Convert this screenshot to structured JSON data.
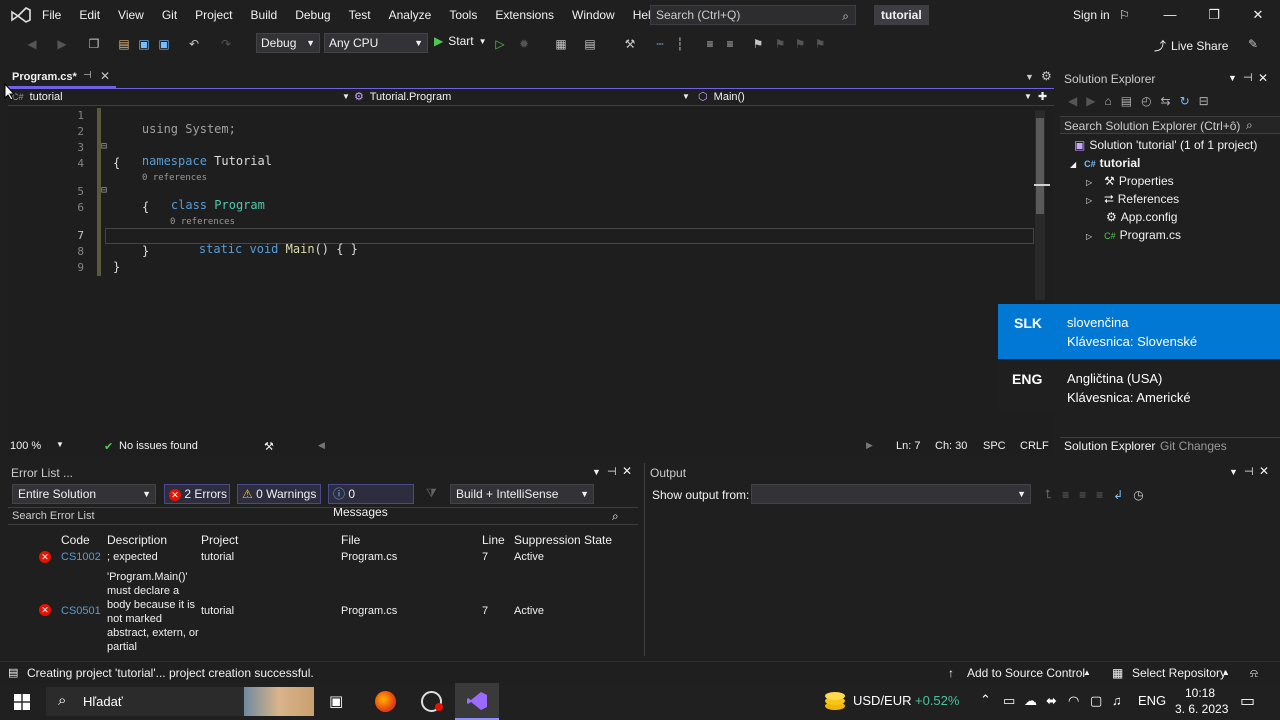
{
  "menubar": {
    "items": [
      "File",
      "Edit",
      "View",
      "Git",
      "Project",
      "Build",
      "Debug",
      "Test",
      "Analyze",
      "Tools",
      "Extensions",
      "Window",
      "Help"
    ],
    "search_placeholder": "Search (Ctrl+Q)",
    "solution_name": "tutorial",
    "sign_in": "Sign in"
  },
  "toolbar": {
    "config": "Debug",
    "platform": "Any CPU",
    "start": "Start",
    "live_share": "Live Share"
  },
  "editor": {
    "tab_label": "Program.cs*",
    "nav_project": "tutorial",
    "nav_class": "Tutorial.Program",
    "nav_member": "Main()",
    "lines": [
      {
        "n": "1",
        "current": false
      },
      {
        "n": "2",
        "current": false
      },
      {
        "n": "3",
        "current": false
      },
      {
        "n": "4",
        "current": false
      },
      {
        "n": "5",
        "current": false
      },
      {
        "n": "6",
        "current": false
      },
      {
        "n": "7",
        "current": true
      },
      {
        "n": "8",
        "current": false
      },
      {
        "n": "9",
        "current": false
      }
    ],
    "code": {
      "using_kw": "using",
      "using_rest": "System;",
      "namespace_kw": "namespace",
      "namespace_name": "Tutorial",
      "open_brace": "{",
      "close_brace": "}",
      "lens_class": "0 references",
      "class_kw": "class",
      "class_name": "Program",
      "lens_method": "0 references",
      "static_kw": "static",
      "void_kw": "void",
      "method_name": "Main",
      "method_rest": "() { }"
    },
    "zoom": "100 %",
    "issues": "No issues found",
    "ln": "Ln: 7",
    "ch": "Ch: 30",
    "spc": "SPC",
    "crlf": "CRLF"
  },
  "solution_explorer": {
    "title": "Solution Explorer",
    "search_placeholder": "Search Solution Explorer (Ctrl+ô)",
    "items": [
      {
        "label": "Solution 'tutorial' (1 of 1 project)",
        "bold": false
      },
      {
        "label": "tutorial",
        "bold": true
      },
      {
        "label": "Properties",
        "bold": false
      },
      {
        "label": "References",
        "bold": false
      },
      {
        "label": "App.config",
        "bold": false
      },
      {
        "label": "Program.cs",
        "bold": false
      }
    ],
    "tab_active": "Solution Explorer",
    "tab_other": "Git Changes"
  },
  "language_popup": {
    "languages": [
      {
        "code": "SLK",
        "name": "slovenčina",
        "keyboard": "Klávesnica: Slovenské",
        "selected": true
      },
      {
        "code": "ENG",
        "name": "Angličtina (USA)",
        "keyboard": "Klávesnica: Americké",
        "selected": false
      }
    ]
  },
  "error_list": {
    "title": "Error List ...",
    "scope": "Entire Solution",
    "errors_btn": "2 Errors",
    "warnings_btn": "0 Warnings",
    "messages_btn": "0 Messages",
    "source": "Build + IntelliSense",
    "search_placeholder": "Search Error List",
    "columns": [
      "Code",
      "Description",
      "Project",
      "File",
      "Line",
      "Suppression State"
    ],
    "rows": [
      {
        "code": "CS1002",
        "description": "; expected",
        "project": "tutorial",
        "file": "Program.cs",
        "line": "7",
        "state": "Active"
      },
      {
        "code": "CS0501",
        "description": "'Program.Main()' must declare a body because it is not marked abstract, extern, or partial",
        "project": "tutorial",
        "file": "Program.cs",
        "line": "7",
        "state": "Active"
      }
    ]
  },
  "output": {
    "title": "Output",
    "show_from": "Show output from:"
  },
  "statusbar": {
    "message": "Creating project 'tutorial'... project creation successful.",
    "add_source": "Add to Source Control",
    "select_repo": "Select Repository"
  },
  "taskbar": {
    "search": "Hľadať",
    "ticker": "USD/EUR",
    "ticker_change": "+0.52%",
    "lang": "ENG",
    "time": "10:18",
    "date": "3. 6. 2023"
  },
  "colors": {
    "accent": "#7160e8",
    "selection": "#0078d4",
    "error": "#e51400",
    "ticker_green": "#4cc2a0"
  }
}
